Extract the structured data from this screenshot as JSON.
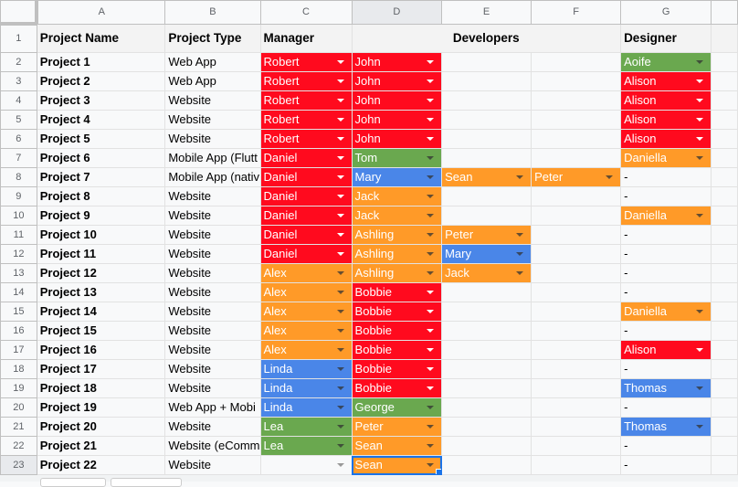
{
  "columns": [
    "A",
    "B",
    "C",
    "D",
    "E",
    "F",
    "G"
  ],
  "header_row": {
    "project_name": "Project Name",
    "project_type": "Project Type",
    "manager": "Manager",
    "developers": "Developers",
    "designer": "Designer"
  },
  "colors": {
    "red": "#ff0a1e",
    "orange": "#ff9a28",
    "green": "#6aa84f",
    "blue": "#4a86e8",
    "selection": "#1a73e8"
  },
  "rows": [
    {
      "n": "2",
      "name": "Project 1",
      "type": "Web App",
      "manager": {
        "v": "Robert",
        "c": "red"
      },
      "dev1": {
        "v": "John",
        "c": "red"
      },
      "dev2": null,
      "dev3": null,
      "designer": {
        "v": "Aoife",
        "c": "green"
      }
    },
    {
      "n": "3",
      "name": "Project 2",
      "type": "Web App",
      "manager": {
        "v": "Robert",
        "c": "red"
      },
      "dev1": {
        "v": "John",
        "c": "red"
      },
      "dev2": null,
      "dev3": null,
      "designer": {
        "v": "Alison",
        "c": "red"
      }
    },
    {
      "n": "4",
      "name": "Project 3",
      "type": "Website",
      "manager": {
        "v": "Robert",
        "c": "red"
      },
      "dev1": {
        "v": "John",
        "c": "red"
      },
      "dev2": null,
      "dev3": null,
      "designer": {
        "v": "Alison",
        "c": "red"
      }
    },
    {
      "n": "5",
      "name": "Project 4",
      "type": "Website",
      "manager": {
        "v": "Robert",
        "c": "red"
      },
      "dev1": {
        "v": "John",
        "c": "red"
      },
      "dev2": null,
      "dev3": null,
      "designer": {
        "v": "Alison",
        "c": "red"
      }
    },
    {
      "n": "6",
      "name": "Project 5",
      "type": "Website",
      "manager": {
        "v": "Robert",
        "c": "red"
      },
      "dev1": {
        "v": "John",
        "c": "red"
      },
      "dev2": null,
      "dev3": null,
      "designer": {
        "v": "Alison",
        "c": "red"
      }
    },
    {
      "n": "7",
      "name": "Project 6",
      "type": "Mobile App (Flutt",
      "manager": {
        "v": "Daniel",
        "c": "red"
      },
      "dev1": {
        "v": "Tom",
        "c": "green"
      },
      "dev2": null,
      "dev3": null,
      "designer": {
        "v": "Daniella",
        "c": "orange"
      }
    },
    {
      "n": "8",
      "name": "Project 7",
      "type": "Mobile App (nativ",
      "manager": {
        "v": "Daniel",
        "c": "red"
      },
      "dev1": {
        "v": "Mary",
        "c": "blue"
      },
      "dev2": {
        "v": "Sean",
        "c": "orange"
      },
      "dev3": {
        "v": "Peter",
        "c": "orange"
      },
      "designer": {
        "v": "-",
        "c": null
      }
    },
    {
      "n": "9",
      "name": "Project 8",
      "type": "Website",
      "manager": {
        "v": "Daniel",
        "c": "red"
      },
      "dev1": {
        "v": "Jack",
        "c": "orange"
      },
      "dev2": null,
      "dev3": null,
      "designer": {
        "v": "-",
        "c": null
      }
    },
    {
      "n": "10",
      "name": "Project 9",
      "type": "Website",
      "manager": {
        "v": "Daniel",
        "c": "red"
      },
      "dev1": {
        "v": "Jack",
        "c": "orange"
      },
      "dev2": null,
      "dev3": null,
      "designer": {
        "v": "Daniella",
        "c": "orange"
      }
    },
    {
      "n": "11",
      "name": "Project 10",
      "type": "Website",
      "manager": {
        "v": "Daniel",
        "c": "red"
      },
      "dev1": {
        "v": "Ashling",
        "c": "orange"
      },
      "dev2": {
        "v": "Peter",
        "c": "orange"
      },
      "dev3": null,
      "designer": {
        "v": "-",
        "c": null
      }
    },
    {
      "n": "12",
      "name": "Project 11",
      "type": "Website",
      "manager": {
        "v": "Daniel",
        "c": "red"
      },
      "dev1": {
        "v": "Ashling",
        "c": "orange"
      },
      "dev2": {
        "v": "Mary",
        "c": "blue"
      },
      "dev3": null,
      "designer": {
        "v": "-",
        "c": null
      }
    },
    {
      "n": "13",
      "name": "Project 12",
      "type": "Website",
      "manager": {
        "v": "Alex",
        "c": "orange"
      },
      "dev1": {
        "v": "Ashling",
        "c": "orange"
      },
      "dev2": {
        "v": "Jack",
        "c": "orange"
      },
      "dev3": null,
      "designer": {
        "v": "-",
        "c": null
      }
    },
    {
      "n": "14",
      "name": "Project 13",
      "type": "Website",
      "manager": {
        "v": "Alex",
        "c": "orange"
      },
      "dev1": {
        "v": "Bobbie",
        "c": "red"
      },
      "dev2": null,
      "dev3": null,
      "designer": {
        "v": "-",
        "c": null
      }
    },
    {
      "n": "15",
      "name": "Project 14",
      "type": "Website",
      "manager": {
        "v": "Alex",
        "c": "orange"
      },
      "dev1": {
        "v": "Bobbie",
        "c": "red"
      },
      "dev2": null,
      "dev3": null,
      "designer": {
        "v": "Daniella",
        "c": "orange"
      }
    },
    {
      "n": "16",
      "name": "Project 15",
      "type": "Website",
      "manager": {
        "v": "Alex",
        "c": "orange"
      },
      "dev1": {
        "v": "Bobbie",
        "c": "red"
      },
      "dev2": null,
      "dev3": null,
      "designer": {
        "v": "-",
        "c": null
      }
    },
    {
      "n": "17",
      "name": "Project 16",
      "type": "Website",
      "manager": {
        "v": "Alex",
        "c": "orange"
      },
      "dev1": {
        "v": "Bobbie",
        "c": "red"
      },
      "dev2": null,
      "dev3": null,
      "designer": {
        "v": "Alison",
        "c": "red"
      }
    },
    {
      "n": "18",
      "name": "Project 17",
      "type": "Website",
      "manager": {
        "v": "Linda",
        "c": "blue"
      },
      "dev1": {
        "v": "Bobbie",
        "c": "red"
      },
      "dev2": null,
      "dev3": null,
      "designer": {
        "v": "-",
        "c": null
      }
    },
    {
      "n": "19",
      "name": "Project 18",
      "type": "Website",
      "manager": {
        "v": "Linda",
        "c": "blue"
      },
      "dev1": {
        "v": "Bobbie",
        "c": "red"
      },
      "dev2": null,
      "dev3": null,
      "designer": {
        "v": "Thomas",
        "c": "blue"
      }
    },
    {
      "n": "20",
      "name": "Project 19",
      "type": "Web App + Mobi",
      "manager": {
        "v": "Linda",
        "c": "blue"
      },
      "dev1": {
        "v": "George",
        "c": "green"
      },
      "dev2": null,
      "dev3": null,
      "designer": {
        "v": "-",
        "c": null
      }
    },
    {
      "n": "21",
      "name": "Project 20",
      "type": "Website",
      "manager": {
        "v": "Lea",
        "c": "green"
      },
      "dev1": {
        "v": "Peter",
        "c": "orange"
      },
      "dev2": null,
      "dev3": null,
      "designer": {
        "v": "Thomas",
        "c": "blue"
      }
    },
    {
      "n": "22",
      "name": "Project 21",
      "type": "Website (eComm",
      "manager": {
        "v": "Lea",
        "c": "green"
      },
      "dev1": {
        "v": "Sean",
        "c": "orange"
      },
      "dev2": null,
      "dev3": null,
      "designer": {
        "v": "-",
        "c": null
      }
    },
    {
      "n": "23",
      "name": "Project 22",
      "type": "Website",
      "manager": {
        "v": "",
        "c": "empty"
      },
      "dev1": {
        "v": "Sean",
        "c": "orange"
      },
      "dev2": null,
      "dev3": null,
      "designer": {
        "v": "-",
        "c": null
      }
    }
  ],
  "selected_cell": "D23"
}
